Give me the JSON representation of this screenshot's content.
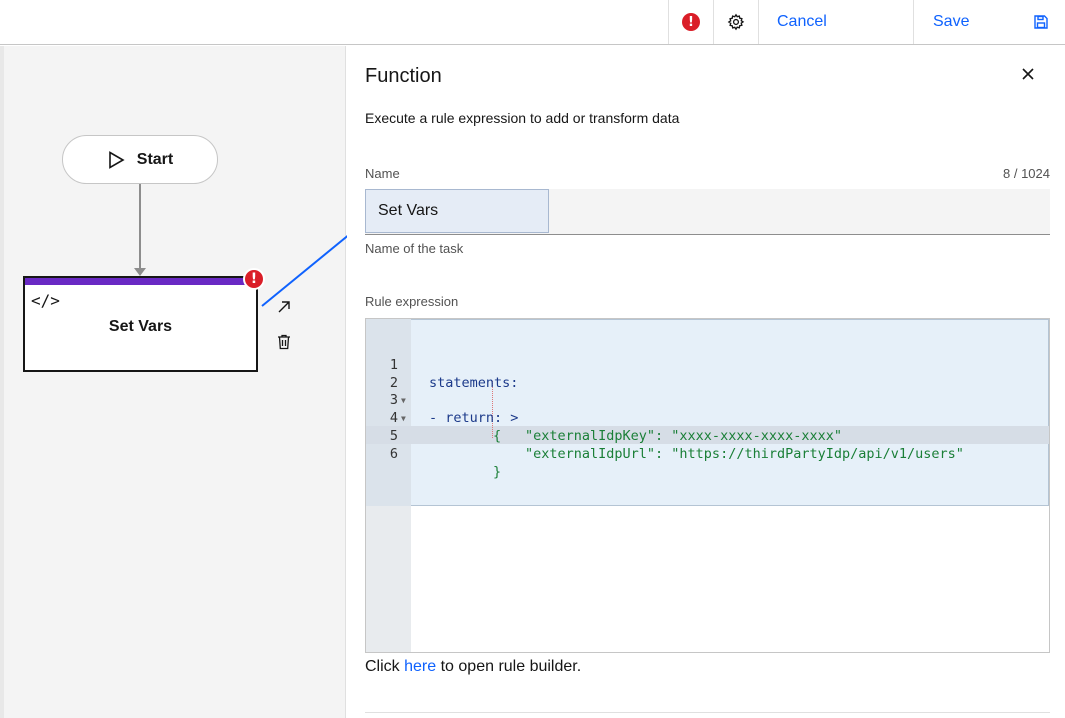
{
  "toolbar": {
    "cancel_label": "Cancel",
    "save_label": "Save",
    "error_icon": "error-filled-icon",
    "settings_icon": "gear-icon",
    "save_icon": "floppy-disk-icon"
  },
  "canvas": {
    "start_node": {
      "label": "Start",
      "icon": "play-icon"
    },
    "task_node": {
      "title": "Set Vars",
      "icon": "code-icon",
      "status": "error"
    },
    "actions": {
      "expand_icon": "arrow-up-right-icon",
      "delete_icon": "trash-can-icon"
    }
  },
  "panel": {
    "title": "Function",
    "description": "Execute a rule expression to add or transform data",
    "name_field": {
      "label": "Name",
      "value": "Set Vars",
      "count": "8 / 1024",
      "helper": "Name of the task"
    },
    "rule_expression": {
      "label": "Rule expression",
      "lines": [
        {
          "number": "1",
          "text": "statements:"
        },
        {
          "number": "2",
          "text": "- return: >"
        },
        {
          "number": "3",
          "text": "{"
        },
        {
          "number": "4",
          "text": "\"externalIdpKey\": \"xxxx-xxxx-xxxx-xxxx\""
        },
        {
          "number": "5",
          "text": "\"externalIdpUrl\": \"https://thirdPartyIdp/api/v1/users\""
        },
        {
          "number": "6",
          "text": "}"
        }
      ]
    },
    "builder_link": {
      "prefix": "Click",
      "link_text": "here",
      "suffix": "to open rule builder."
    }
  },
  "colors": {
    "accent": "#0f62fe",
    "error": "#da1e28",
    "task_bar": "#6929c4"
  }
}
